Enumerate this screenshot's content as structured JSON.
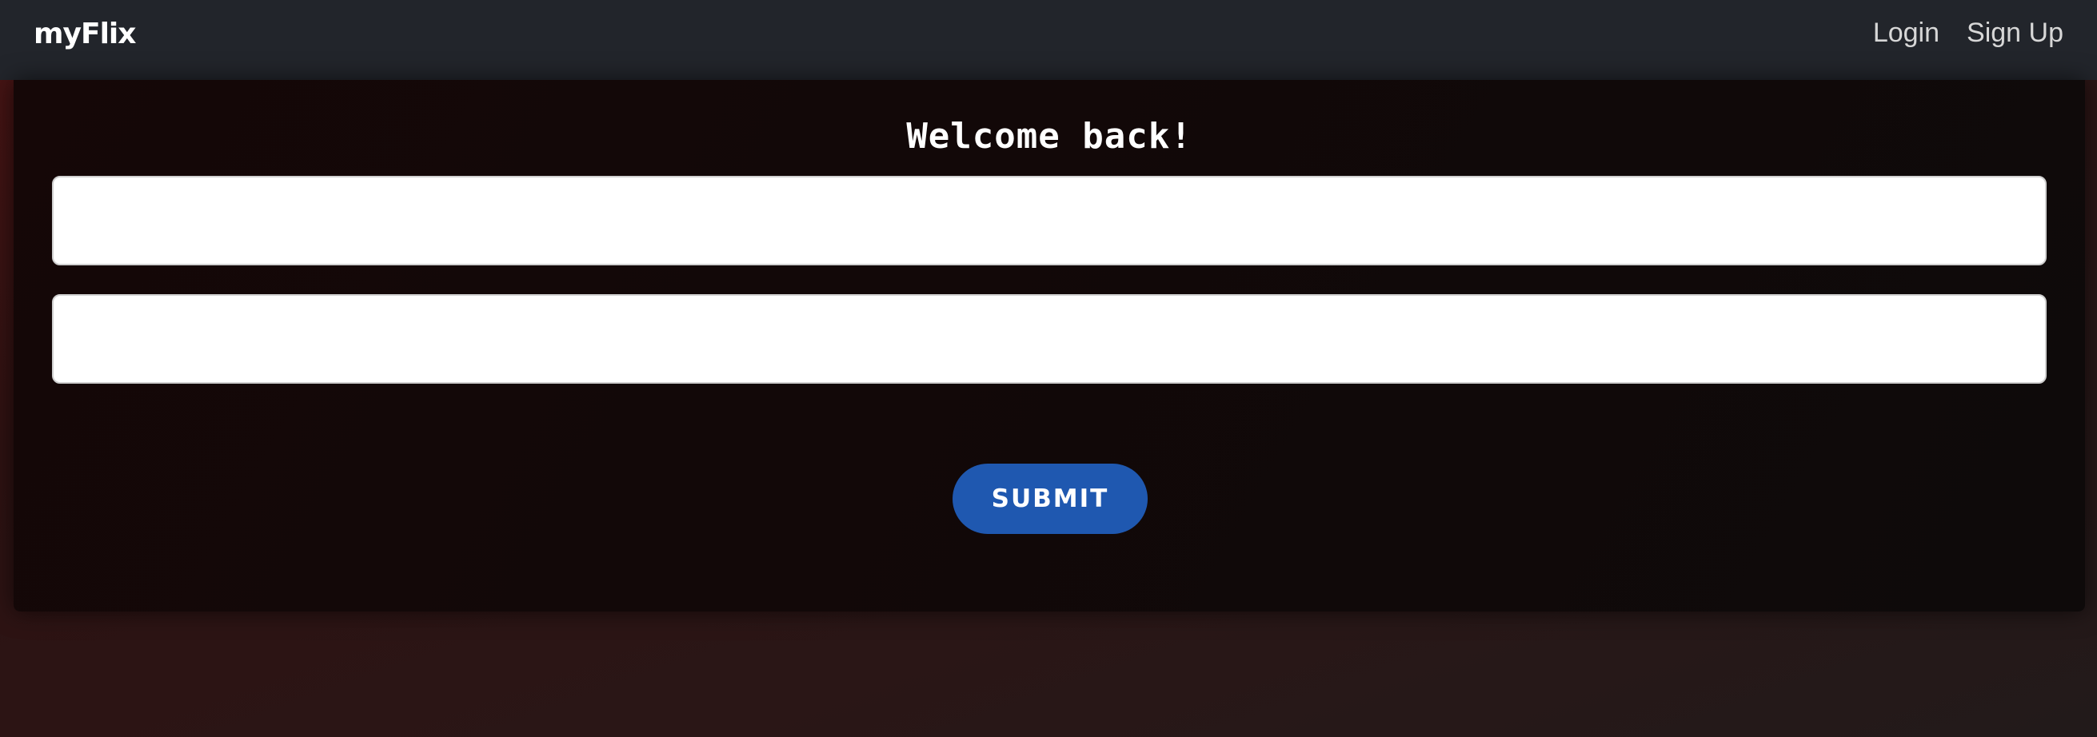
{
  "navbar": {
    "brand": "myFlix",
    "links": [
      "Login",
      "Sign Up"
    ]
  },
  "login_form": {
    "title": "Welcome back!",
    "username": {
      "value": "",
      "placeholder": ""
    },
    "password": {
      "value": "",
      "placeholder": ""
    },
    "submit_label": "SUBMIT"
  },
  "colors": {
    "navbar_bg": "#22252b",
    "card_bg": "#120808",
    "accent": "#1f58b0"
  }
}
